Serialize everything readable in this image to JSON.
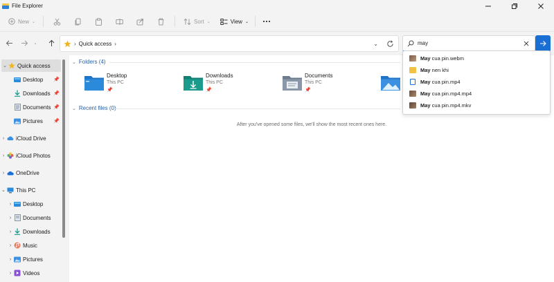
{
  "window": {
    "title": "File Explorer"
  },
  "toolbar": {
    "new_label": "New",
    "sort_label": "Sort",
    "view_label": "View"
  },
  "address": {
    "path": "Quick access"
  },
  "search": {
    "value": "may"
  },
  "sidebar": {
    "items": [
      {
        "label": "Quick access",
        "icon": "star-icon"
      },
      {
        "label": "Desktop",
        "icon": "desktop-icon"
      },
      {
        "label": "Downloads",
        "icon": "download-icon"
      },
      {
        "label": "Documents",
        "icon": "documents-icon"
      },
      {
        "label": "Pictures",
        "icon": "pictures-icon"
      },
      {
        "label": "iCloud Drive",
        "icon": "cloud-icon"
      },
      {
        "label": "iCloud Photos",
        "icon": "photos-icon"
      },
      {
        "label": "OneDrive",
        "icon": "onedrive-icon"
      },
      {
        "label": "This PC",
        "icon": "computer-icon"
      },
      {
        "label": "Desktop",
        "icon": "desktop-icon"
      },
      {
        "label": "Documents",
        "icon": "documents-icon"
      },
      {
        "label": "Downloads",
        "icon": "download-icon"
      },
      {
        "label": "Music",
        "icon": "music-icon"
      },
      {
        "label": "Pictures",
        "icon": "pictures-icon"
      },
      {
        "label": "Videos",
        "icon": "videos-icon"
      }
    ]
  },
  "main": {
    "folders_header": "Folders (4)",
    "recent_header": "Recent files (0)",
    "empty_message": "After you've opened some files, we'll show the most recent ones here.",
    "folders": [
      {
        "name": "Desktop",
        "location": "This PC"
      },
      {
        "name": "Downloads",
        "location": "This PC"
      },
      {
        "name": "Documents",
        "location": "This PC"
      },
      {
        "name": "",
        "location": ""
      }
    ]
  },
  "suggestions": [
    {
      "match": "May",
      "rest": " cua pin.webm",
      "icon": "video-thumb-icon"
    },
    {
      "match": "May",
      "rest": " nen khi",
      "icon": "folder-icon"
    },
    {
      "match": "May",
      "rest": " cua pin.mp4",
      "icon": "media-file-icon"
    },
    {
      "match": "May",
      "rest": " cua pin.mp4.mp4",
      "icon": "video-thumb-icon"
    },
    {
      "match": "May",
      "rest": " cua pin.mp4.mkv",
      "icon": "video-thumb-icon"
    }
  ],
  "colors": {
    "accent": "#1a6fd4",
    "folder_blue": "#2b8ad9",
    "folder_teal": "#1a9b8c",
    "folder_gray": "#8a97a8"
  }
}
